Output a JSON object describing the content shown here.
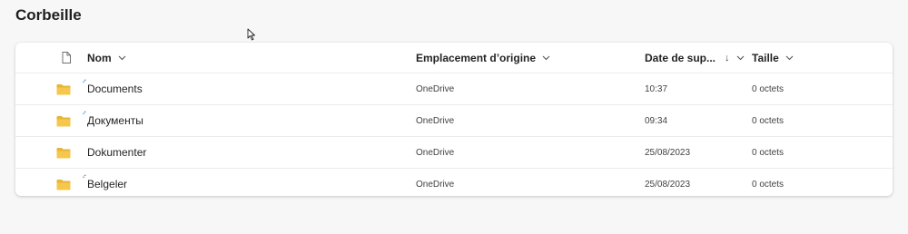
{
  "page": {
    "title": "Corbeille"
  },
  "table": {
    "headers": {
      "name": "Nom",
      "location": "Emplacement d’origine",
      "date": "Date de sup...",
      "sort_indicator": "↓",
      "size": "Taille"
    },
    "rows": [
      {
        "name": "Documents",
        "location": "OneDrive",
        "date": "10:37",
        "size": "0 octets"
      },
      {
        "name": "Документы",
        "location": "OneDrive",
        "date": "09:34",
        "size": "0 octets"
      },
      {
        "name": "Dokumenter",
        "location": "OneDrive",
        "date": "25/08/2023",
        "size": "0 octets"
      },
      {
        "name": "Belgeler",
        "location": "OneDrive",
        "date": "25/08/2023",
        "size": "0 octets"
      }
    ]
  },
  "icons": {
    "file_type_header": "file-icon",
    "folder": "folder-icon",
    "sync": "sync-status-icon",
    "cursor": "mouse-cursor-icon"
  },
  "colors": {
    "folder": "#f5c84c",
    "folder_dark": "#e8b43a",
    "sync": "#3a86d4"
  }
}
